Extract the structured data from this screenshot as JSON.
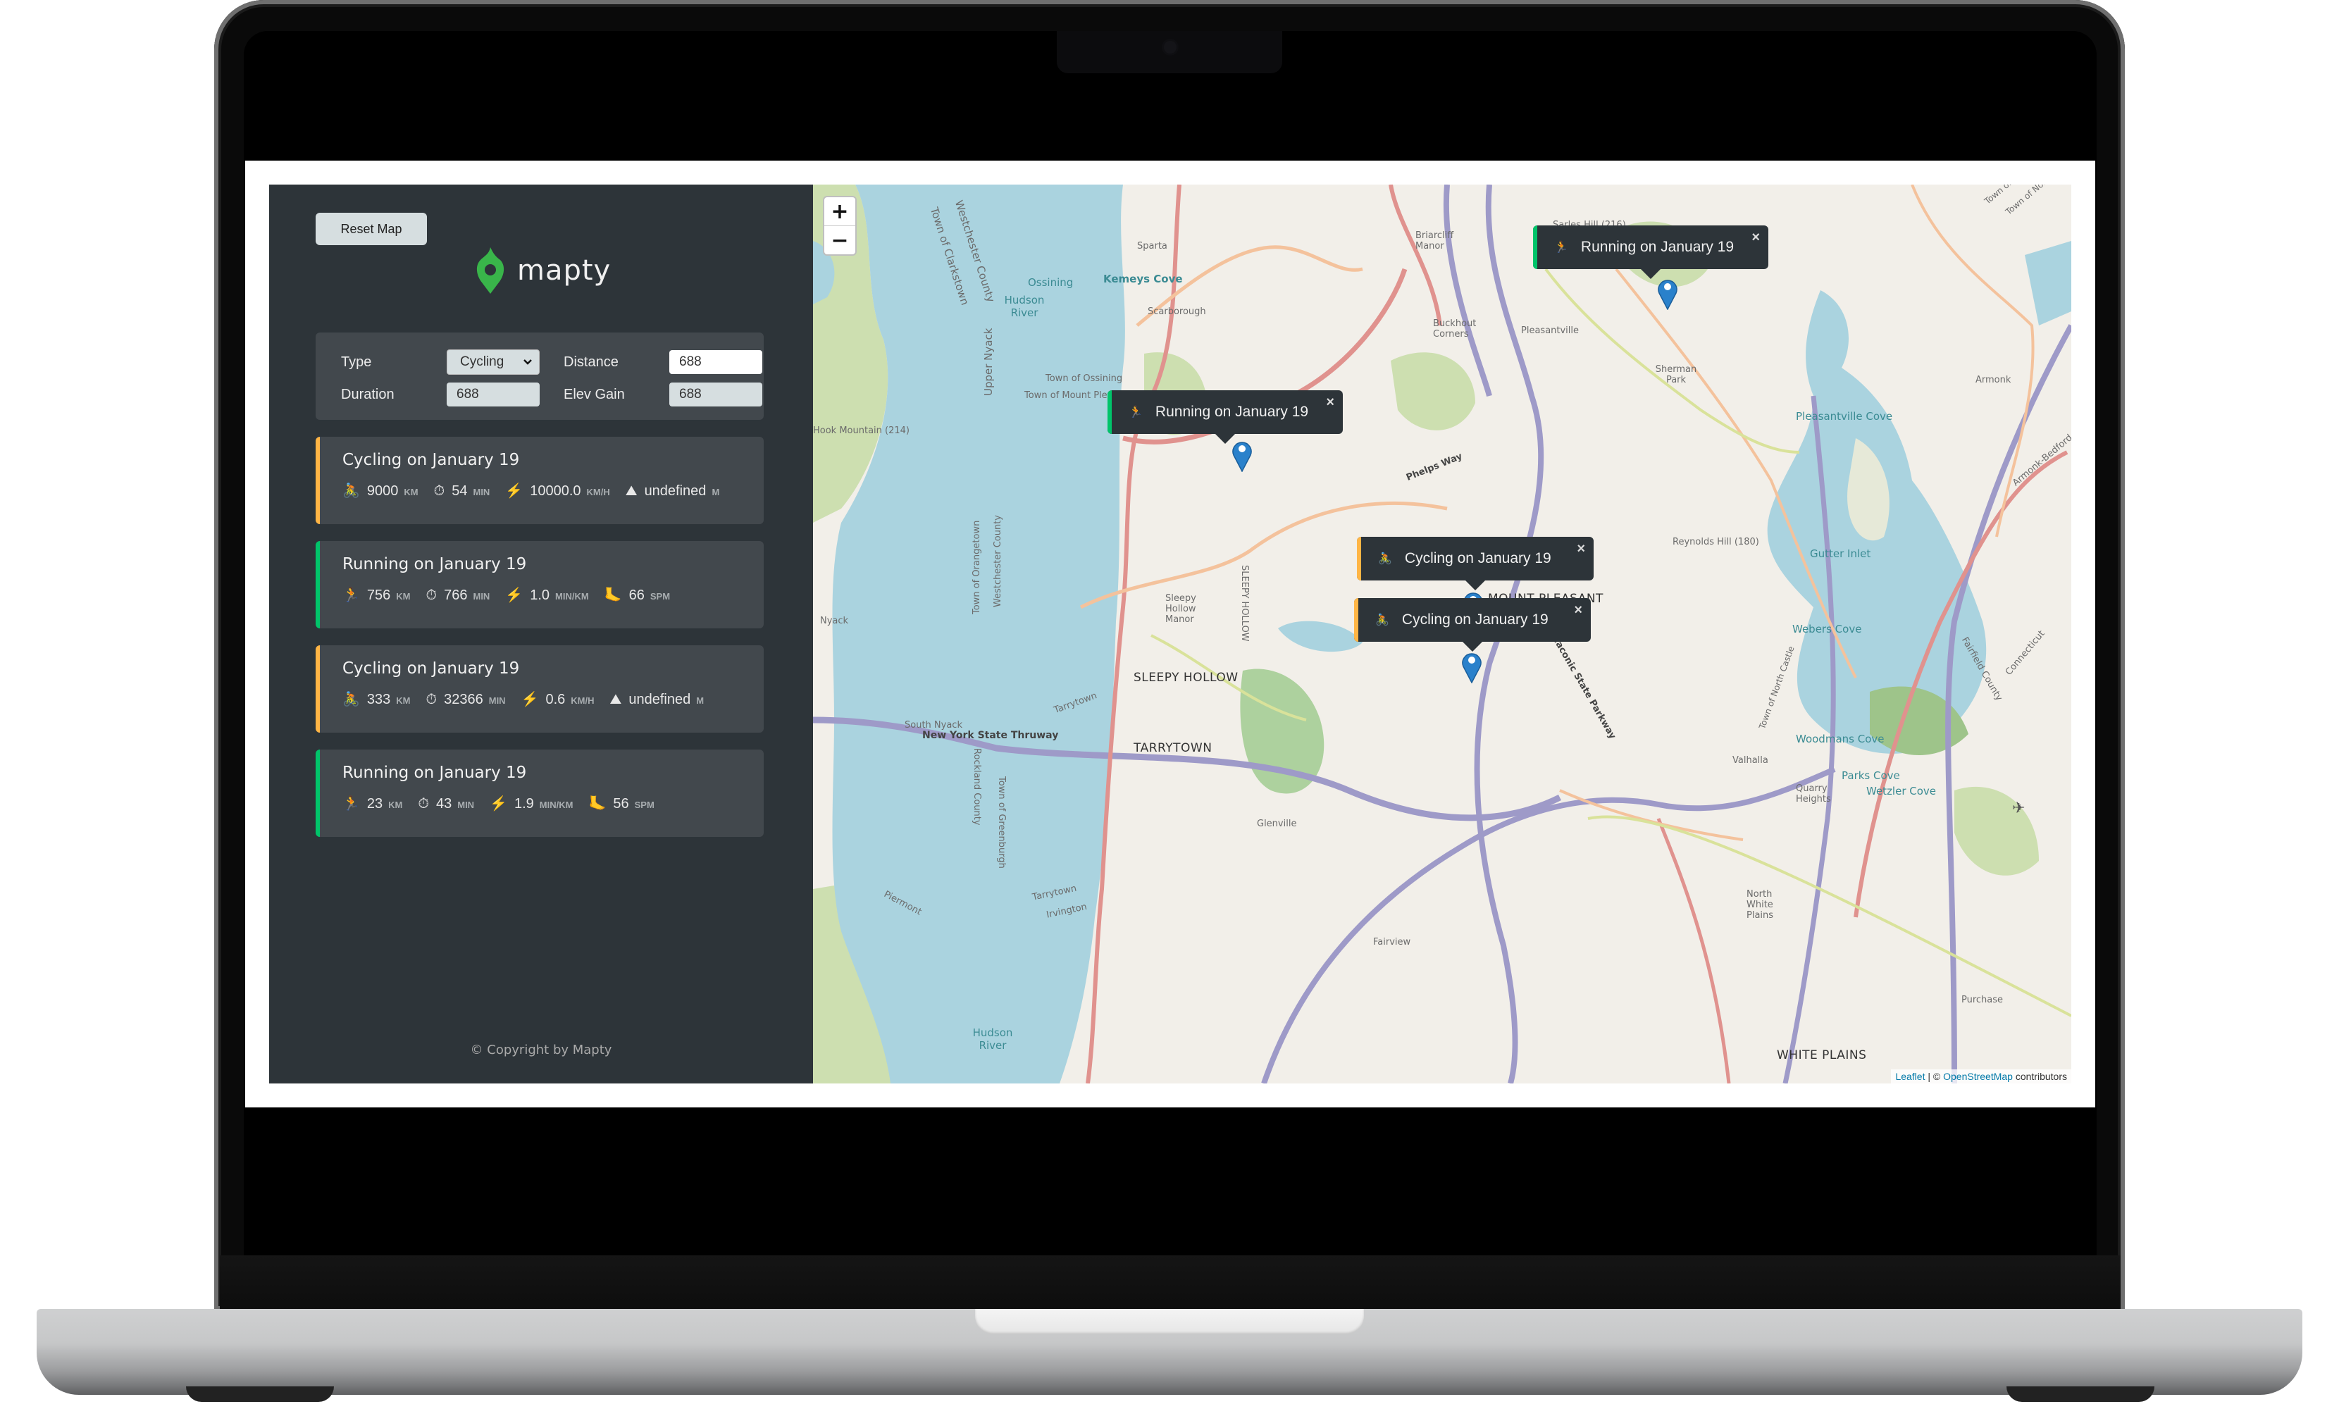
{
  "app": {
    "name": "mapty",
    "reset_button": "Reset Map",
    "copyright": "© Copyright by Mapty",
    "colors": {
      "sidebar_bg": "#2d3439",
      "panel_bg": "#42484d",
      "cycling_accent": "#ffb545",
      "running_accent": "#00c46a",
      "marker_blue": "#2a81cb"
    }
  },
  "form": {
    "type_label": "Type",
    "type_value": "Cycling",
    "distance_label": "Distance",
    "distance_value": "688",
    "duration_label": "Duration",
    "duration_value": "688",
    "elev_label": "Elev Gain",
    "elev_value": "688"
  },
  "workouts": [
    {
      "type": "cycling",
      "title": "Cycling on January 19",
      "details": [
        {
          "icon": "cyclist-icon",
          "glyph": "🚴",
          "value": "9000",
          "unit": "km"
        },
        {
          "icon": "stopwatch-icon",
          "glyph": "⏱",
          "value": "54",
          "unit": "min"
        },
        {
          "icon": "lightning-icon",
          "glyph": "⚡",
          "value": "10000.0",
          "unit": "km/h"
        },
        {
          "icon": "mountain-icon",
          "glyph": "⛰",
          "value": "undefined",
          "unit": "m"
        }
      ]
    },
    {
      "type": "running",
      "title": "Running on January 19",
      "details": [
        {
          "icon": "runner-icon",
          "glyph": "🏃",
          "value": "756",
          "unit": "km"
        },
        {
          "icon": "stopwatch-icon",
          "glyph": "⏱",
          "value": "766",
          "unit": "min"
        },
        {
          "icon": "lightning-icon",
          "glyph": "⚡",
          "value": "1.0",
          "unit": "min/km"
        },
        {
          "icon": "footprint-icon",
          "glyph": "🦶",
          "value": "66",
          "unit": "spm"
        }
      ]
    },
    {
      "type": "cycling",
      "title": "Cycling on January 19",
      "details": [
        {
          "icon": "cyclist-icon",
          "glyph": "🚴",
          "value": "333",
          "unit": "km"
        },
        {
          "icon": "stopwatch-icon",
          "glyph": "⏱",
          "value": "32366",
          "unit": "min"
        },
        {
          "icon": "lightning-icon",
          "glyph": "⚡",
          "value": "0.6",
          "unit": "km/h"
        },
        {
          "icon": "mountain-icon",
          "glyph": "⛰",
          "value": "undefined",
          "unit": "m"
        }
      ]
    },
    {
      "type": "running",
      "title": "Running on January 19",
      "details": [
        {
          "icon": "runner-icon",
          "glyph": "🏃",
          "value": "23",
          "unit": "km"
        },
        {
          "icon": "stopwatch-icon",
          "glyph": "⏱",
          "value": "43",
          "unit": "min"
        },
        {
          "icon": "lightning-icon",
          "glyph": "⚡",
          "value": "1.9",
          "unit": "min/km"
        },
        {
          "icon": "footprint-icon",
          "glyph": "🦶",
          "value": "56",
          "unit": "spm"
        }
      ]
    }
  ],
  "map": {
    "zoom_in": "+",
    "zoom_out": "−",
    "popups": [
      {
        "type": "running",
        "glyph": "🏃",
        "text": "Running on January 19",
        "close": "×"
      },
      {
        "type": "running",
        "glyph": "🏃",
        "text": "Running on January 19",
        "close": "×"
      },
      {
        "type": "cycling",
        "glyph": "🚴",
        "text": "Cycling on January 19",
        "close": "×"
      },
      {
        "type": "cycling",
        "glyph": "🚴",
        "text": "Cycling on January 19",
        "close": "×"
      }
    ],
    "labels": {
      "hudson_river_n": "Hudson River",
      "hudson_river_s": "Hudson River",
      "ossining": "Ossining",
      "town_ossining": "Town of Ossining",
      "town_mount_pleasant": "Town of Mount Pleasant",
      "westchester_county": "Westchester County",
      "town_clarkstown": "Town of Clarkstown",
      "upper_nyack": "Upper Nyack",
      "mountain": "Hook Mountain (214)",
      "kemeys_cove": "Kemeys Cove",
      "sparta": "Sparta",
      "scarborough": "Scarborough",
      "briarcliff_manor": "Briarcliff Manor",
      "buckhout_corners": "Buckhout Corners",
      "pleasantville": "Pleasantville",
      "sarles_hill": "Sarles Hill (216)",
      "sherman_park": "Sherman Park",
      "pleasantville_cove": "Pleasantville Cove",
      "armonk": "Armonk",
      "armonk_bedford_road": "Armonk-Bedford Road",
      "reynolds_hill": "Reynolds Hill (180)",
      "gutter_inlet": "Gutter Inlet",
      "mount_pleasant": "MOUNT PLEASANT",
      "sleepy_hollow": "SLEEPY HOLLOW",
      "tarrytown": "TARRYTOWN",
      "nyack": "Nyack",
      "south_nyack": "South Nyack",
      "ny_thruway": "New York State Thruway",
      "rockland_county": "Rockland County",
      "town_greenburgh": "Town of Greenburgh",
      "town_orangetown": "Town of Orangetown",
      "piermont": "Piermont",
      "irvington": "Irvington",
      "tarrytown_small": "Tarrytown",
      "glenville": "Glenville",
      "fairview": "Fairview",
      "valhalla": "Valhalla",
      "webers_cove": "Webers Cove",
      "woodmans_cove": "Woodmans Cove",
      "parks_cove": "Parks Cove",
      "wetzler_cove": "Wetzler Cove",
      "quarry_heights": "Quarry Heights",
      "north_white_plains": "North White Plains",
      "white_plains": "WHITE PLAINS",
      "purchase": "Purchase",
      "fairfield_county": "Fairfield County",
      "connecticut": "Connecticut",
      "town_north_castle": "Town of North Castle",
      "town_new_castle": "Town of New Castle",
      "phelps_way": "Phelps Way",
      "taconic_parkway": "Taconic State Parkway",
      "sleepy_hollow_manor": "Sleepy Hollow Manor"
    },
    "attribution": {
      "leaflet": "Leaflet",
      "separator": " | © ",
      "osm": "OpenStreetMap",
      "suffix": " contributors"
    }
  }
}
